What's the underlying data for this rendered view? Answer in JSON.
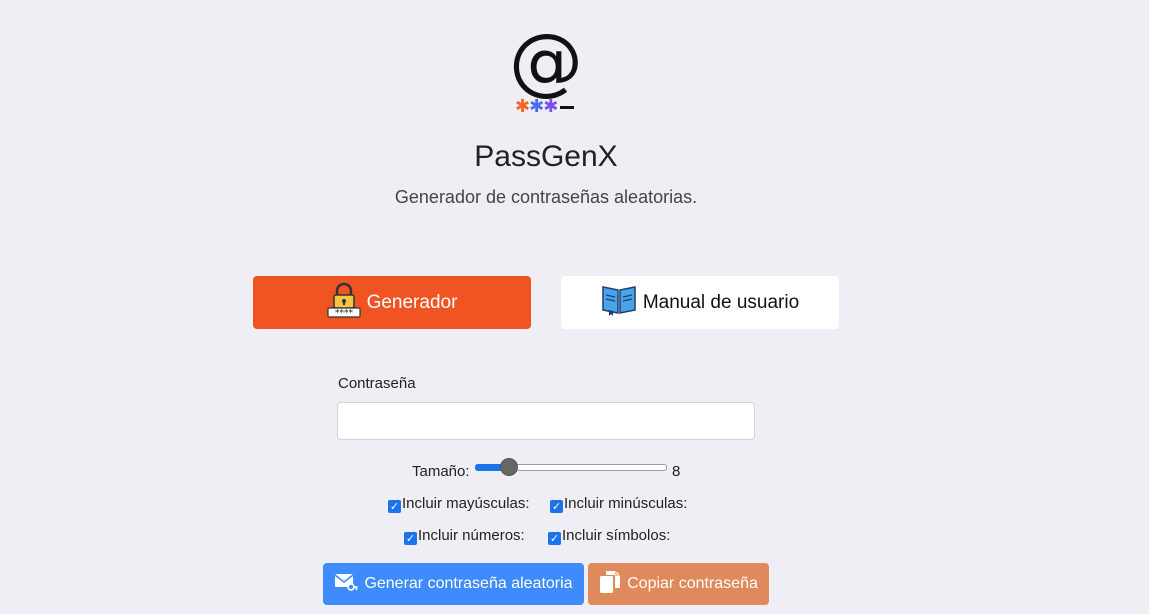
{
  "header": {
    "title": "PassGenX",
    "subtitle": "Generador de contraseñas aleatorias.",
    "logo_icon": "at-sign-with-password-stars-logo"
  },
  "tabs": [
    {
      "label": "Generador",
      "icon": "padlock-password-icon",
      "active": true,
      "color": "#f05422"
    },
    {
      "label": "Manual de usuario",
      "icon": "open-book-icon",
      "active": false
    }
  ],
  "form": {
    "password_label": "Contraseña",
    "password_value": "",
    "size_label": "Tamaño:",
    "size_value": "8",
    "size_min": 4,
    "size_max": 32,
    "options": [
      {
        "label": "Incluir mayúsculas:",
        "checked": true
      },
      {
        "label": "Incluir minúsculas:",
        "checked": true
      },
      {
        "label": "Incluir números:",
        "checked": true
      },
      {
        "label": "Incluir símbolos:",
        "checked": true
      }
    ],
    "generate_button": "Generar contraseña aleatoria",
    "copy_button": "Copiar contraseña"
  },
  "colors": {
    "accent": "#f05422",
    "primary": "#3d8bfd",
    "copy": "#e0895a",
    "background": "#efeef4"
  }
}
